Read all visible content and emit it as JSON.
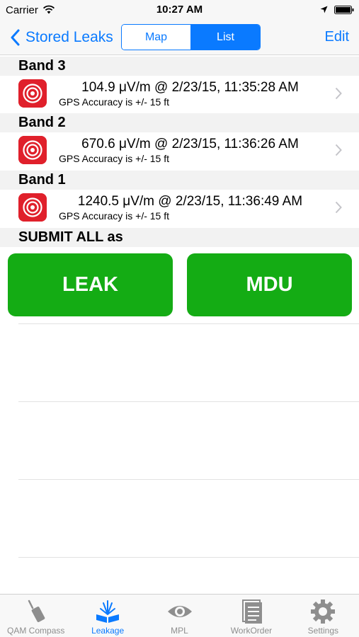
{
  "status_bar": {
    "carrier": "Carrier",
    "time": "10:27 AM"
  },
  "nav": {
    "back_label": "Stored Leaks",
    "segments": {
      "map": "Map",
      "list": "List",
      "selected": "List"
    },
    "edit_label": "Edit"
  },
  "sections": [
    {
      "title": "Band 3",
      "reading": "104.9 μV/m @ 2/23/15, 11:35:28 AM",
      "accuracy": "GPS Accuracy is +/- 15 ft"
    },
    {
      "title": "Band 2",
      "reading": "670.6 μV/m @ 2/23/15, 11:36:26 AM",
      "accuracy": "GPS Accuracy is +/- 15 ft"
    },
    {
      "title": "Band 1",
      "reading": "1240.5 μV/m @ 2/23/15, 11:36:49 AM",
      "accuracy": "GPS Accuracy is +/- 15 ft"
    }
  ],
  "submit": {
    "label": "SUBMIT ALL as",
    "leak_button": "LEAK",
    "mdu_button": "MDU"
  },
  "tabs": [
    {
      "label": "QAM Compass",
      "icon": "antenna-icon",
      "active": false
    },
    {
      "label": "Leakage",
      "icon": "leakage-icon",
      "active": true
    },
    {
      "label": "MPL",
      "icon": "eye-icon",
      "active": false
    },
    {
      "label": "WorkOrder",
      "icon": "document-stack-icon",
      "active": false
    },
    {
      "label": "Settings",
      "icon": "gear-icon",
      "active": false
    }
  ],
  "colors": {
    "accent": "#0a7aff",
    "button_green": "#14ac14",
    "leak_red": "#e0202b"
  }
}
